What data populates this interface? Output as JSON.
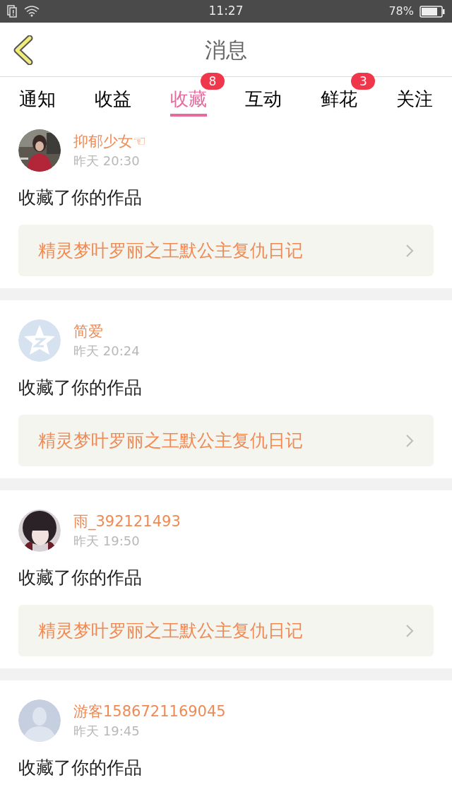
{
  "status_bar": {
    "time": "11:27",
    "battery": "78%"
  },
  "header": {
    "title": "消息"
  },
  "tabs": [
    {
      "label": "通知",
      "selected": false
    },
    {
      "label": "收益",
      "selected": false
    },
    {
      "label": "收藏",
      "selected": true,
      "badge": "8"
    },
    {
      "label": "互动",
      "selected": false
    },
    {
      "label": "鲜花",
      "selected": false,
      "badge": "3"
    },
    {
      "label": "关注",
      "selected": false
    }
  ],
  "messages": [
    {
      "name": "抑郁少女☜",
      "time": "昨天 20:30",
      "action": "收藏了你的作品",
      "work": "精灵梦叶罗丽之王默公主复仇日记"
    },
    {
      "avatar": {
        "kind": "star"
      },
      "name": "简爱",
      "time": "昨天 20:24",
      "action": "收藏了你的作品",
      "work": "精灵梦叶罗丽之王默公主复仇日记"
    },
    {
      "avatar": {
        "kind": "photo2"
      },
      "name": "雨_392121493",
      "time": "昨天 19:50",
      "action": "收藏了你的作品",
      "work": "精灵梦叶罗丽之王默公主复仇日记"
    },
    {
      "avatar": {
        "kind": "silhouette"
      },
      "name": "游客1586721169045",
      "time": "昨天 19:45",
      "action": "收藏了你的作品"
    }
  ]
}
